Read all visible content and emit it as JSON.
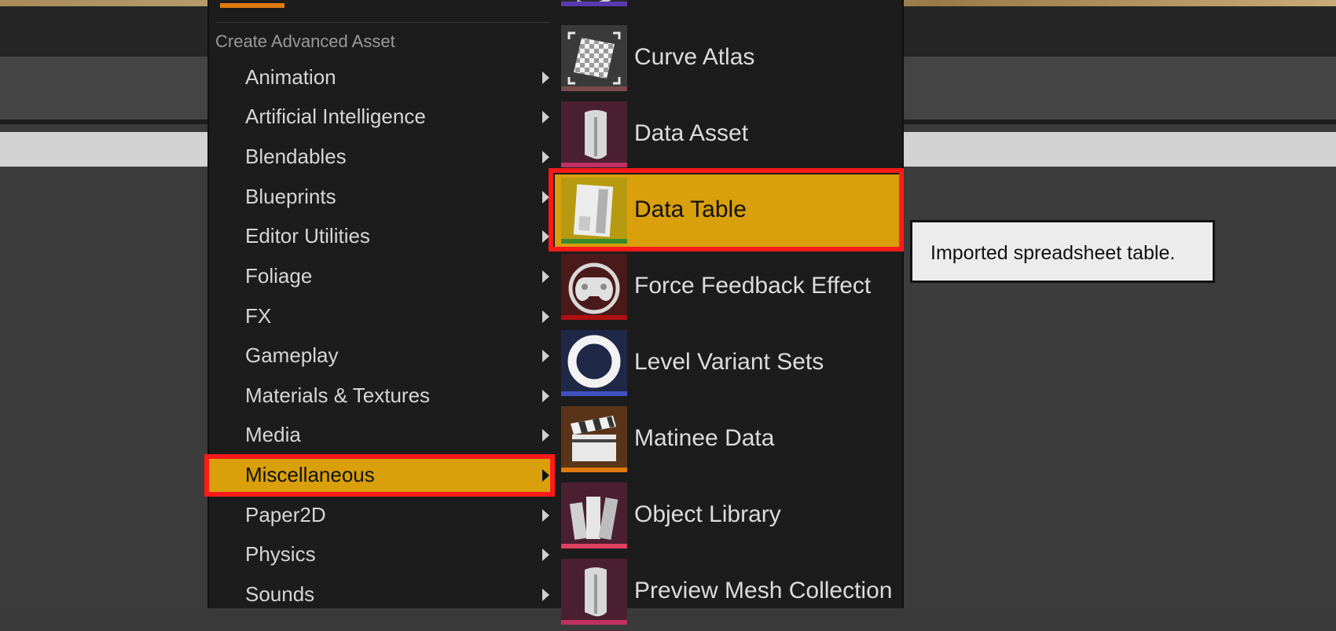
{
  "left_menu": {
    "section_label": "Create Advanced Asset",
    "items": [
      {
        "label": "Animation"
      },
      {
        "label": "Artificial Intelligence"
      },
      {
        "label": "Blendables"
      },
      {
        "label": "Blueprints"
      },
      {
        "label": "Editor Utilities"
      },
      {
        "label": "Foliage"
      },
      {
        "label": "FX"
      },
      {
        "label": "Gameplay"
      },
      {
        "label": "Materials & Textures"
      },
      {
        "label": "Media"
      },
      {
        "label": "Miscellaneous",
        "selected": true
      },
      {
        "label": "Paper2D"
      },
      {
        "label": "Physics"
      },
      {
        "label": "Sounds"
      }
    ]
  },
  "submenu": {
    "items": [
      {
        "label": "Curve Atlas",
        "icon": "curve-atlas-icon",
        "bar_color": "#7a4a4a"
      },
      {
        "label": "Data Asset",
        "icon": "data-asset-icon",
        "bar_color": "#c03060"
      },
      {
        "label": "Data Table",
        "icon": "data-table-icon",
        "bar_color": "#3a8a2a",
        "selected": true
      },
      {
        "label": "Force Feedback Effect",
        "icon": "force-feedback-icon",
        "bar_color": "#b01010"
      },
      {
        "label": "Level Variant Sets",
        "icon": "level-variant-sets-icon",
        "bar_color": "#4050c0"
      },
      {
        "label": "Matinee Data",
        "icon": "matinee-data-icon",
        "bar_color": "#e07a10"
      },
      {
        "label": "Object Library",
        "icon": "object-library-icon",
        "bar_color": "#e04060"
      },
      {
        "label": "Preview Mesh Collection",
        "icon": "preview-mesh-collection-icon",
        "bar_color": "#c03060"
      }
    ]
  },
  "tooltip": {
    "text": "Imported spreadsheet table."
  },
  "colors": {
    "selection": "#d9a00c",
    "highlight_border": "#ff1a1a",
    "menu_bg": "#1c1c1c"
  }
}
